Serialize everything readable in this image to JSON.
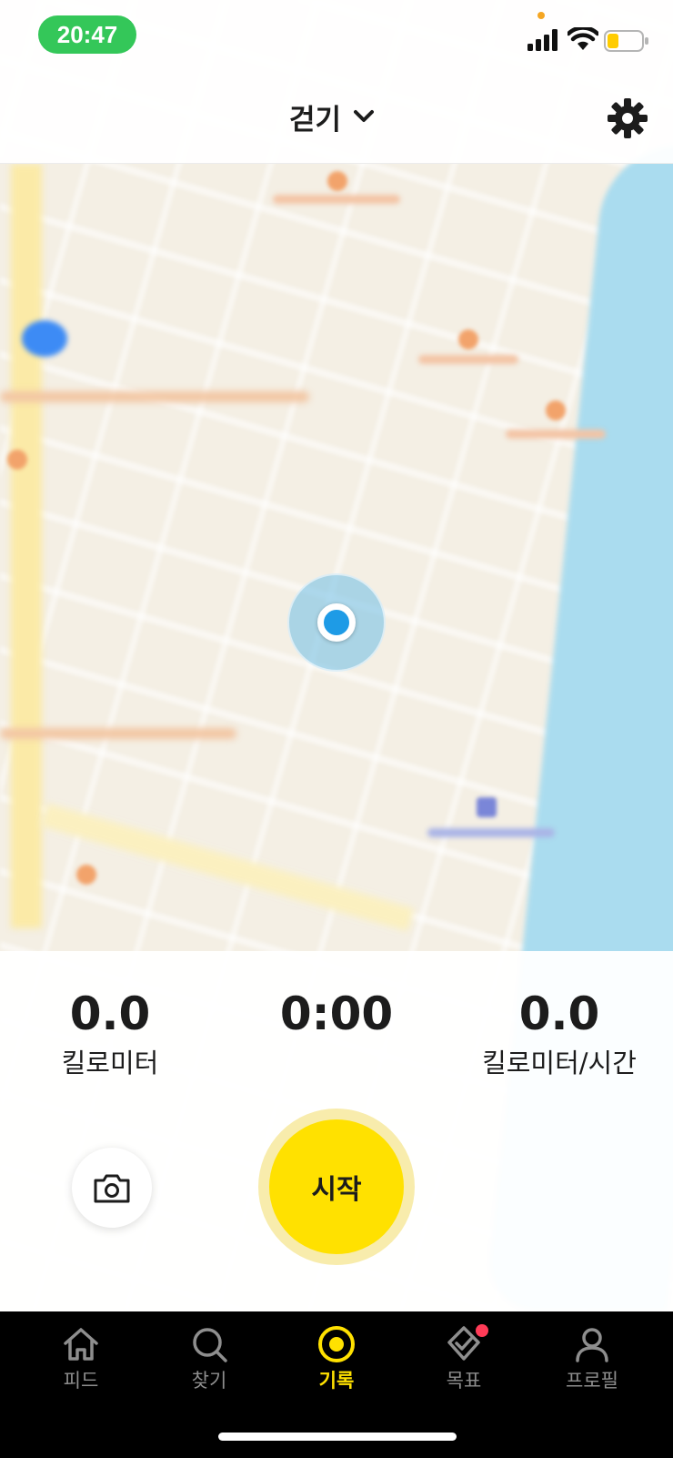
{
  "status_bar": {
    "time": "20:47"
  },
  "header": {
    "activity_type": "걷기"
  },
  "stats": [
    {
      "value": "0.0",
      "label": "킬로미터"
    },
    {
      "value": "0:00",
      "label": ""
    },
    {
      "value": "0.0",
      "label": "킬로미터/시간"
    }
  ],
  "controls": {
    "start_label": "시작"
  },
  "tabs": [
    {
      "label": "피드",
      "icon": "home-icon",
      "active": false
    },
    {
      "label": "찾기",
      "icon": "search-icon",
      "active": false
    },
    {
      "label": "기록",
      "icon": "record-icon",
      "active": true
    },
    {
      "label": "목표",
      "icon": "goal-icon",
      "active": false,
      "badge": true
    },
    {
      "label": "프로필",
      "icon": "profile-icon",
      "active": false
    }
  ],
  "colors": {
    "accent": "#ffe100",
    "status_time_bg": "#34c759",
    "location": "#1e9be6",
    "badge": "#ff3b57"
  }
}
